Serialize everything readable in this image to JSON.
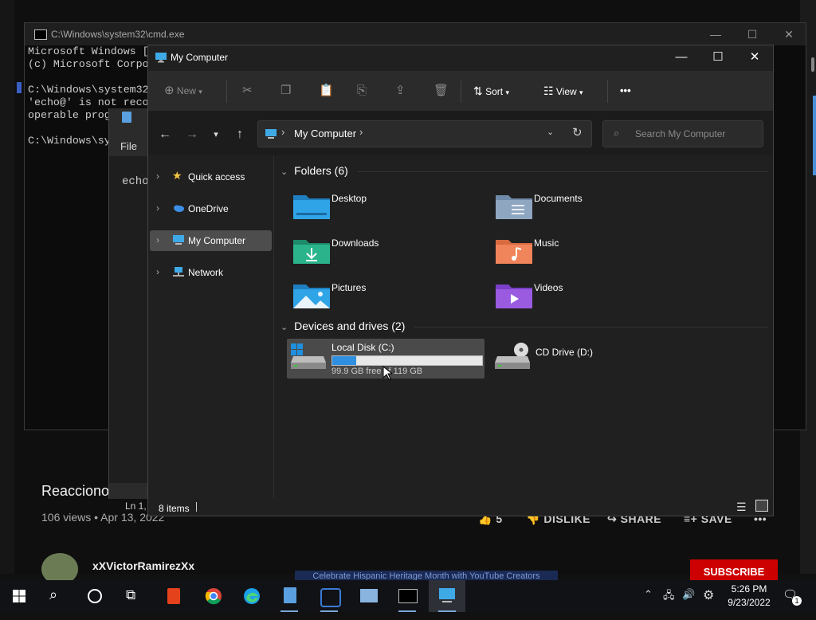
{
  "youtube": {
    "video_title": "Reacciono",
    "views": "106 views • Apr 13, 2022",
    "likes": "5",
    "dislike": "DISLIKE",
    "share": "SHARE",
    "save": "SAVE",
    "channel": "xXVictorRamirezXx",
    "banner": "Celebrate Hispanic Heritage Month with YouTube Creators",
    "subscribe": "SUBSCRIBE"
  },
  "cmd": {
    "title": "C:\\Windows\\system32\\cmd.exe",
    "lines": "Microsoft Windows [\n(c) Microsoft Corpo\n\nC:\\Windows\\system32\n'echo@' is not reco\noperable prog\n\nC:\\Windows\\sy"
  },
  "notepad": {
    "menu_file": "File",
    "text": "echo",
    "status": "Ln 1,"
  },
  "explorer": {
    "title": "My Computer",
    "toolbar": {
      "new": "New",
      "sort": "Sort",
      "view": "View",
      "more": "•••"
    },
    "address": "My Computer",
    "search_placeholder": "Search My Computer",
    "sidebar": [
      {
        "label": "Quick access",
        "icon": "star-icon",
        "color": "#f5c542"
      },
      {
        "label": "OneDrive",
        "icon": "cloud-icon",
        "color": "#3d8ee8"
      },
      {
        "label": "My Computer",
        "icon": "monitor-icon",
        "color": "#3fa9e6",
        "selected": true
      },
      {
        "label": "Network",
        "icon": "network-icon",
        "color": "#3fa9e6"
      }
    ],
    "folders_header": "Folders (6)",
    "folders": [
      {
        "label": "Desktop",
        "icon": "desktop-folder-icon",
        "color": "#2fa4e7"
      },
      {
        "label": "Documents",
        "icon": "documents-folder-icon",
        "color": "#8fa6c0"
      },
      {
        "label": "Downloads",
        "icon": "downloads-folder-icon",
        "color": "#2bb48c"
      },
      {
        "label": "Music",
        "icon": "music-folder-icon",
        "color": "#f0845a"
      },
      {
        "label": "Pictures",
        "icon": "pictures-folder-icon",
        "color": "#2fa4e7"
      },
      {
        "label": "Videos",
        "icon": "videos-folder-icon",
        "color": "#9a5be0"
      }
    ],
    "drives_header": "Devices and drives (2)",
    "drives": [
      {
        "label": "Local Disk (C:)",
        "free": "99.9 GB free of 119 GB",
        "used_fraction": 0.16
      },
      {
        "label": "CD Drive (D:)"
      }
    ],
    "status_items": "8 items"
  },
  "taskbar": {
    "time": "5:26 PM",
    "date": "9/23/2022",
    "notifications": "1",
    "apps": [
      "start-icon",
      "search-icon",
      "cortana-icon",
      "task-view-icon",
      "office-icon",
      "chrome-icon",
      "edge-icon",
      "notepad-icon",
      "connect-icon",
      "image-viewer-icon",
      "terminal-icon",
      "my-computer-icon"
    ]
  }
}
